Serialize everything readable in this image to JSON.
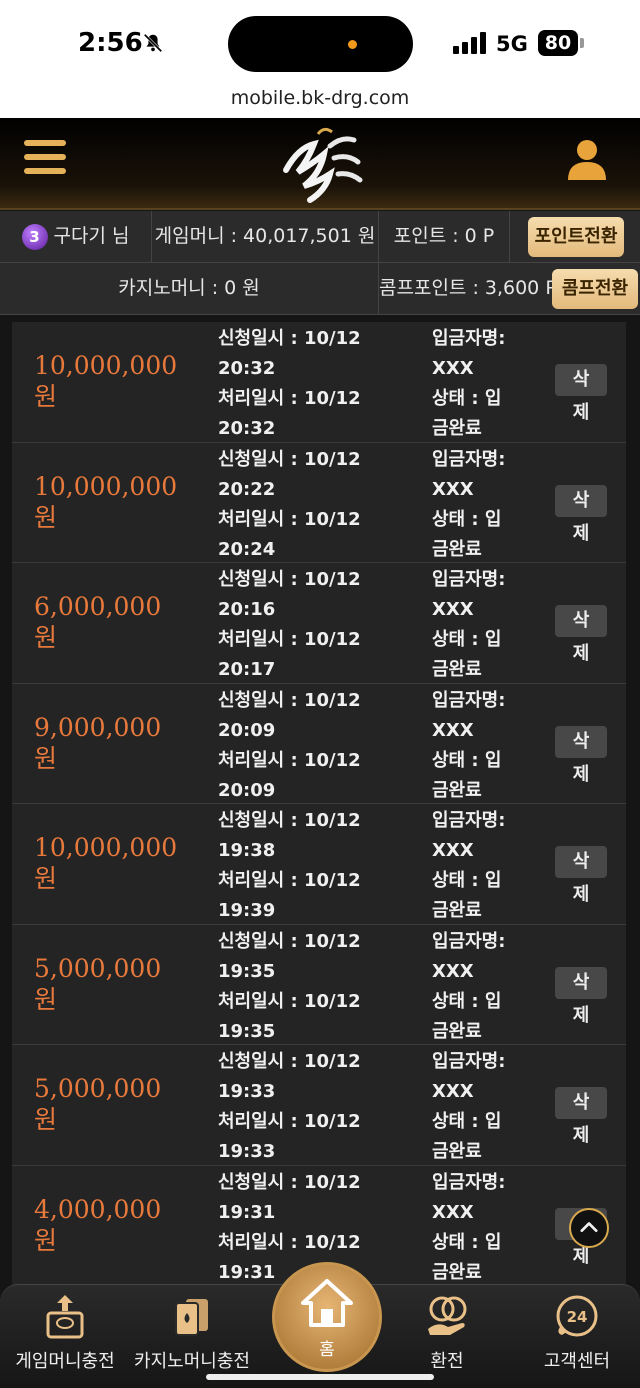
{
  "status": {
    "time": "2:56",
    "network": "5G",
    "battery": "80"
  },
  "browser": {
    "url": "mobile.bk-drg.com"
  },
  "colors": {
    "accent_gold": "#e3ba7c",
    "amount_orange": "#e8793c",
    "background": "#151515"
  },
  "user": {
    "level": "3",
    "name": "구다기 님",
    "game_money": "게임머니 : 40,017,501 원",
    "point": "포인트 : 0 P",
    "point_convert": "포인트전환",
    "casino_money": "카지노머니 : 0 원",
    "comp_point": "콤프포인트 : 3,600 P",
    "comp_convert": "콤프전환"
  },
  "labels": {
    "request_prefix": "신청일시 : 10/12",
    "process_prefix": "처리일시 : 10/12",
    "depositor": "입금자명:",
    "depositor_value": "XXX",
    "status_1": "상태 : 입",
    "status_2": "금완료",
    "delete_1": "삭",
    "delete_2": "제",
    "won": "원"
  },
  "deposits": [
    {
      "amount": "10,000,000",
      "request_time": "20:32",
      "process_time": "20:32"
    },
    {
      "amount": "10,000,000",
      "request_time": "20:22",
      "process_time": "20:24"
    },
    {
      "amount": "6,000,000",
      "request_time": "20:16",
      "process_time": "20:17"
    },
    {
      "amount": "9,000,000",
      "request_time": "20:09",
      "process_time": "20:09"
    },
    {
      "amount": "10,000,000",
      "request_time": "19:38",
      "process_time": "19:39"
    },
    {
      "amount": "5,000,000",
      "request_time": "19:35",
      "process_time": "19:35"
    },
    {
      "amount": "5,000,000",
      "request_time": "19:33",
      "process_time": "19:33"
    },
    {
      "amount": "4,000,000",
      "request_time": "19:31",
      "process_time": "19:31"
    }
  ],
  "nav": {
    "game_charge": "게임머니충전",
    "casino_charge": "카지노머니충전",
    "home": "홈",
    "exchange": "환전",
    "support": "고객센터",
    "support_badge": "24"
  },
  "icons": {
    "menu": "hamburger-icon",
    "user": "user-icon",
    "scroll_top": "chevron-up-icon",
    "home": "home-icon"
  }
}
